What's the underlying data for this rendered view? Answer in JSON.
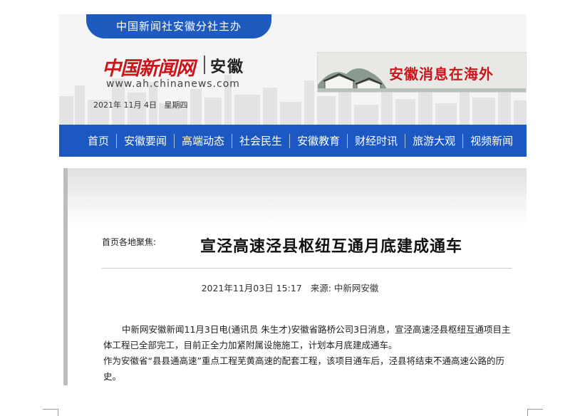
{
  "header": {
    "sponsor": "中国新闻社安徽分社主办",
    "logo_name": "中国新闻网",
    "logo_region": "安徽",
    "logo_url": "www.ah.chinanews.com",
    "date": "2021年 11月 4日",
    "weekday": "星期四",
    "banner_text": "安徽消息在海外"
  },
  "nav": {
    "items": [
      "首页",
      "安徽要闻",
      "高端动态",
      "社会民生",
      "安徽教育",
      "财经时讯",
      "旅游大观",
      "视频新闻"
    ]
  },
  "article": {
    "breadcrumb": "首页各地聚焦:",
    "title": "宣泾高速泾县枢纽互通月底建成通车",
    "datetime": "2021年11月03日 15:17",
    "source_label": "来源:",
    "source": "中新网安徽",
    "paragraphs": [
      "中新网安徽新闻11月3日电(通讯员  朱生才)安徽省路桥公司3日消息，宣泾高速泾县枢纽互通项目主体工程已全部完工，目前正全力加紧附属设施施工，计划本月底建成通车。",
      "作为安徽省“县县通高速”重点工程芜黄高速的配套工程，该项目通车后，泾县将结束不通高速公路的历史。"
    ]
  }
}
